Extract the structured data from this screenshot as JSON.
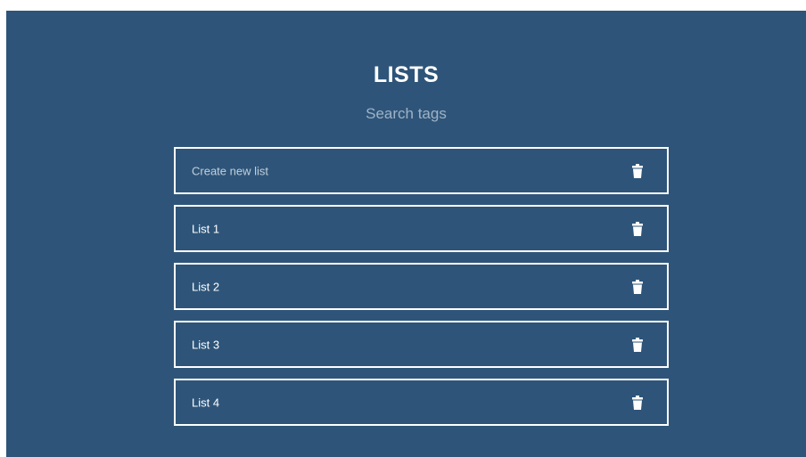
{
  "header": {
    "title": "LISTS",
    "search_placeholder": "Search tags"
  },
  "lists": {
    "create_label": "Create new list",
    "items": [
      {
        "label": "List 1"
      },
      {
        "label": "List 2"
      },
      {
        "label": "List 3"
      },
      {
        "label": "List 4"
      }
    ]
  },
  "icons": {
    "delete": "trash-icon"
  },
  "colors": {
    "background": "#2e5579",
    "border": "#ffffff",
    "text": "#ffffff",
    "muted_text": "#9fb2c6"
  }
}
